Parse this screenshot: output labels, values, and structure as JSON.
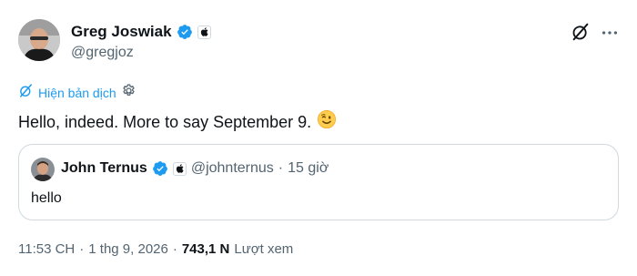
{
  "post": {
    "author": {
      "display_name": "Greg Joswiak",
      "handle": "@gregjoz",
      "avatar_icon": "avatar-photo",
      "verified_icon": "verified-badge-icon",
      "affiliation_icon": "apple-logo-icon"
    },
    "actions": {
      "grok_icon": "grok-icon",
      "more_icon": "more-dots-icon"
    },
    "translate": {
      "label": "Hiện bản dịch",
      "icon": "translate-icon",
      "settings_icon": "gear-icon"
    },
    "text": "Hello, indeed. More to say September 9.",
    "emoji": "😉",
    "quote": {
      "display_name": "John Ternus",
      "handle": "@johnternus",
      "separator": "·",
      "time": "15 giờ",
      "text": "hello",
      "verified_icon": "verified-badge-icon",
      "affiliation_icon": "apple-logo-icon"
    },
    "meta": {
      "time": "11:53 CH",
      "separator1": "·",
      "date": "1 thg 9, 2026",
      "separator2": "·",
      "views_count": "743,1 N",
      "views_label": "Lượt xem"
    }
  },
  "colors": {
    "accent": "#1d9bf0",
    "text": "#0f1419",
    "secondary": "#536471",
    "border": "#cfd9de"
  }
}
